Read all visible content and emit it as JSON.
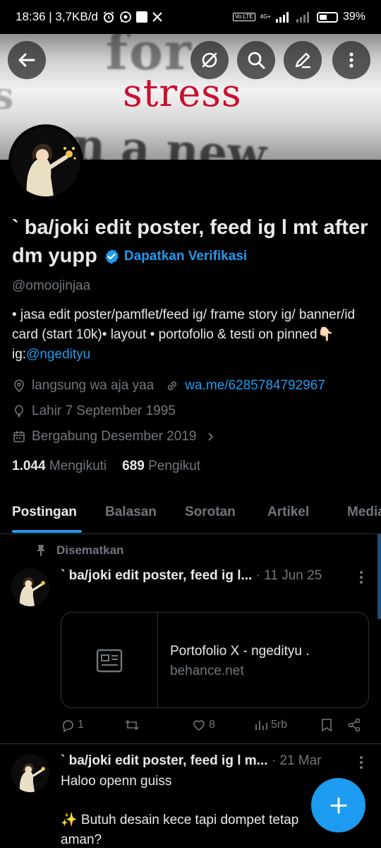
{
  "status_bar": {
    "time_speed": "18:36 | 3,7KB/d",
    "volte": "Vo LTE",
    "network": "4G+",
    "battery": "39%"
  },
  "banner": {
    "headline_word": "stress",
    "ghost_text_1": "for",
    "ghost_text_2": "s",
    "ghost_text_3": "on a new"
  },
  "profile": {
    "display_name": "` ba/joki edit poster, feed ig l mt after dm yupp",
    "verify_cta": "Dapatkan Verifikasi",
    "handle": "@omoojinjaa",
    "bio_text": "• jasa edit poster/pamflet/feed ig/ frame story ig/ banner/id card (start 10k)• layout • portofolio & testi on pinned👇🏻 ig:",
    "bio_link": "@ngedityu",
    "location": "langsung wa aja yaa",
    "website": "wa.me/6285784792967",
    "birthday": "Lahir 7 September 1995",
    "joined": "Bergabung Desember 2019",
    "following_count": "1.044",
    "following_label": "Mengikuti",
    "followers_count": "689",
    "followers_label": "Pengikut"
  },
  "tabs": [
    {
      "label": "Postingan",
      "active": true
    },
    {
      "label": "Balasan",
      "active": false
    },
    {
      "label": "Sorotan",
      "active": false
    },
    {
      "label": "Artikel",
      "active": false
    },
    {
      "label": "Media",
      "active": false
    }
  ],
  "posts": [
    {
      "pinned_label": "Disematkan",
      "author": "` ba/joki edit poster, feed ig l...",
      "date": "· 11 Jun 25",
      "card_title": "Portofolio X - ngedityu .",
      "card_domain": "behance.net",
      "replies": "1",
      "likes": "8",
      "views": "5rb"
    },
    {
      "author": "` ba/joki edit poster, feed ig l m...",
      "date": "· 21 Mar",
      "line1": "Haloo openn guiss",
      "line2": "✨ Butuh desain kece tapi dompet tetap",
      "line3": "aman?"
    }
  ],
  "colors": {
    "accent": "#1d9bf0",
    "muted": "#71767b",
    "text": "#e7e9ea",
    "border": "#2f3336"
  }
}
